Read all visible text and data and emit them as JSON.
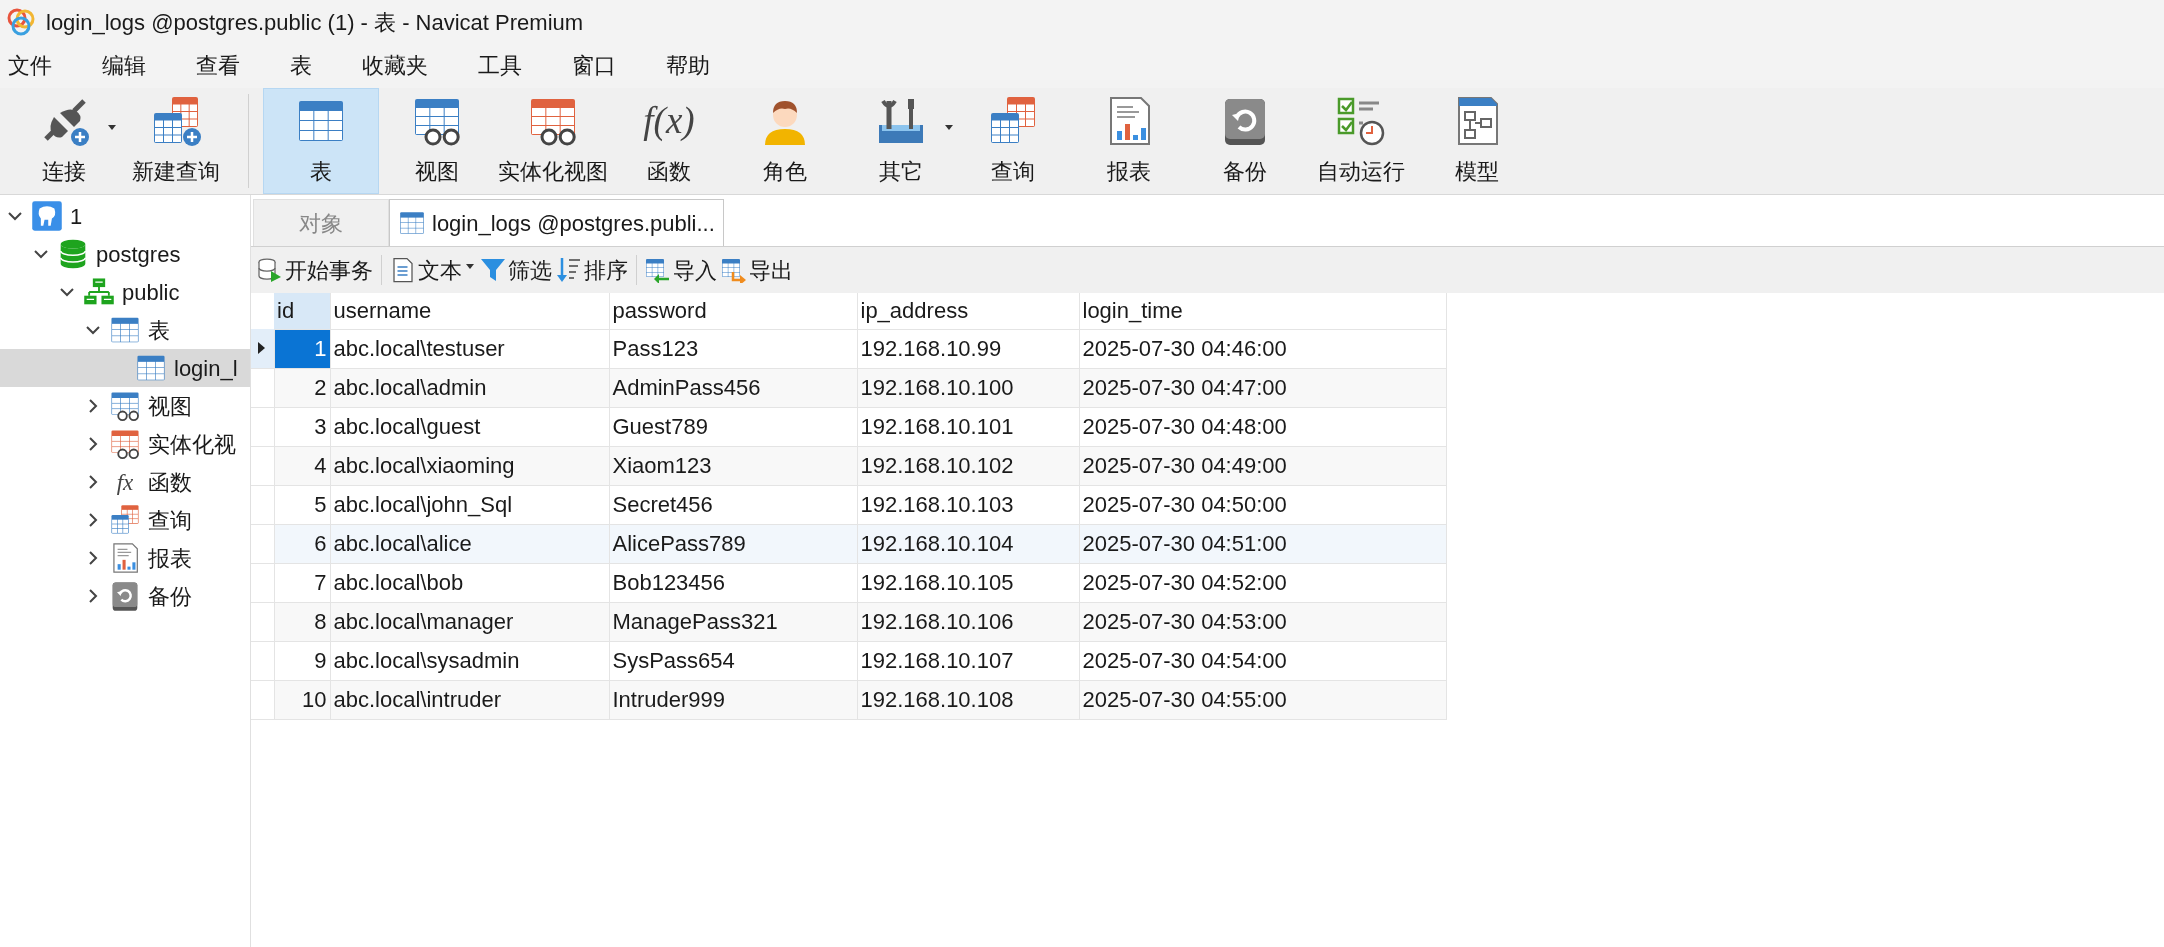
{
  "window": {
    "title": "login_logs @postgres.public (1) - 表 - Navicat Premium"
  },
  "menu": [
    {
      "label": "文件"
    },
    {
      "label": "编辑"
    },
    {
      "label": "查看"
    },
    {
      "label": "表"
    },
    {
      "label": "收藏夹"
    },
    {
      "label": "工具"
    },
    {
      "label": "窗口"
    },
    {
      "label": "帮助"
    }
  ],
  "toolbar": [
    {
      "kind": "connect",
      "label": "连接",
      "selected": false,
      "dropdown": true
    },
    {
      "kind": "new-query",
      "label": "新建查询",
      "selected": false,
      "dropdown": false
    },
    {
      "kind": "table",
      "label": "表",
      "selected": true,
      "dropdown": false
    },
    {
      "kind": "view",
      "label": "视图",
      "selected": false,
      "dropdown": false
    },
    {
      "kind": "mview",
      "label": "实体化视图",
      "selected": false,
      "dropdown": false
    },
    {
      "kind": "function",
      "label": "函数",
      "selected": false,
      "dropdown": false,
      "glyph": "f(x)"
    },
    {
      "kind": "role",
      "label": "角色",
      "selected": false,
      "dropdown": false
    },
    {
      "kind": "other",
      "label": "其它",
      "selected": false,
      "dropdown": true
    },
    {
      "kind": "query",
      "label": "查询",
      "selected": false,
      "dropdown": false
    },
    {
      "kind": "report",
      "label": "报表",
      "selected": false,
      "dropdown": false
    },
    {
      "kind": "backup",
      "label": "备份",
      "selected": false,
      "dropdown": false
    },
    {
      "kind": "automation",
      "label": "自动运行",
      "selected": false,
      "dropdown": false
    },
    {
      "kind": "model",
      "label": "模型",
      "selected": false,
      "dropdown": false
    }
  ],
  "sidebar": {
    "tree": [
      {
        "kind": "connection",
        "label": "1",
        "expanded": true,
        "selected": false,
        "children": [
          {
            "kind": "database",
            "label": "postgres",
            "expanded": true,
            "selected": false,
            "children": [
              {
                "kind": "schema",
                "label": "public",
                "expanded": true,
                "selected": false,
                "children": [
                  {
                    "kind": "table",
                    "label": "表",
                    "expanded": true,
                    "selected": false,
                    "children": [
                      {
                        "kind": "table",
                        "label": "login_l",
                        "selected": true
                      }
                    ]
                  },
                  {
                    "kind": "view",
                    "label": "视图",
                    "expanded": false,
                    "selected": false
                  },
                  {
                    "kind": "mview",
                    "label": "实体化视",
                    "expanded": false,
                    "selected": false
                  },
                  {
                    "kind": "function",
                    "label": "函数",
                    "expanded": false,
                    "selected": false,
                    "glyph": "fx"
                  },
                  {
                    "kind": "query",
                    "label": "查询",
                    "expanded": false,
                    "selected": false
                  },
                  {
                    "kind": "report",
                    "label": "报表",
                    "expanded": false,
                    "selected": false
                  },
                  {
                    "kind": "backup",
                    "label": "备份",
                    "expanded": false,
                    "selected": false
                  }
                ]
              }
            ]
          }
        ]
      }
    ]
  },
  "tabs": [
    {
      "label": "对象",
      "selected": false,
      "kind": "plain"
    },
    {
      "label": "login_logs @postgres.publi...",
      "selected": true,
      "kind": "table"
    }
  ],
  "grid_toolbar": [
    {
      "kind": "transaction",
      "label": "开始事务",
      "dropdown": false
    },
    {
      "kind": "text",
      "label": "文本",
      "dropdown": true
    },
    {
      "kind": "filter",
      "label": "筛选",
      "dropdown": false
    },
    {
      "kind": "sort",
      "label": "排序",
      "dropdown": false
    },
    {
      "kind": "import",
      "label": "导入",
      "dropdown": false
    },
    {
      "kind": "export",
      "label": "导出",
      "dropdown": false
    }
  ],
  "table": {
    "columns": [
      {
        "label": "id",
        "selected": true
      },
      {
        "label": "username",
        "selected": false
      },
      {
        "label": "password",
        "selected": false
      },
      {
        "label": "ip_address",
        "selected": false
      },
      {
        "label": "login_time",
        "selected": false
      }
    ],
    "rows": [
      {
        "selected": true,
        "hovered": false,
        "cells": [
          "1",
          "abc.local\\testuser",
          "Pass123",
          "192.168.10.99",
          "2025-07-30 04:46:00"
        ]
      },
      {
        "selected": false,
        "hovered": false,
        "cells": [
          "2",
          "abc.local\\admin",
          "AdminPass456",
          "192.168.10.100",
          "2025-07-30 04:47:00"
        ]
      },
      {
        "selected": false,
        "hovered": false,
        "cells": [
          "3",
          "abc.local\\guest",
          "Guest789",
          "192.168.10.101",
          "2025-07-30 04:48:00"
        ]
      },
      {
        "selected": false,
        "hovered": false,
        "cells": [
          "4",
          "abc.local\\xiaoming",
          "Xiaom123",
          "192.168.10.102",
          "2025-07-30 04:49:00"
        ]
      },
      {
        "selected": false,
        "hovered": false,
        "cells": [
          "5",
          "abc.local\\john_Sql",
          "Secret456",
          "192.168.10.103",
          "2025-07-30 04:50:00"
        ]
      },
      {
        "selected": false,
        "hovered": true,
        "cells": [
          "6",
          "abc.local\\alice",
          "AlicePass789",
          "192.168.10.104",
          "2025-07-30 04:51:00"
        ]
      },
      {
        "selected": false,
        "hovered": false,
        "cells": [
          "7",
          "abc.local\\bob",
          "Bob123456",
          "192.168.10.105",
          "2025-07-30 04:52:00"
        ]
      },
      {
        "selected": false,
        "hovered": false,
        "cells": [
          "8",
          "abc.local\\manager",
          "ManagePass321",
          "192.168.10.106",
          "2025-07-30 04:53:00"
        ]
      },
      {
        "selected": false,
        "hovered": false,
        "cells": [
          "9",
          "abc.local\\sysadmin",
          "SysPass654",
          "192.168.10.107",
          "2025-07-30 04:54:00"
        ]
      },
      {
        "selected": false,
        "hovered": false,
        "cells": [
          "10",
          "abc.local\\intruder",
          "Intruder999",
          "192.168.10.108",
          "2025-07-30 04:55:00"
        ]
      }
    ]
  }
}
